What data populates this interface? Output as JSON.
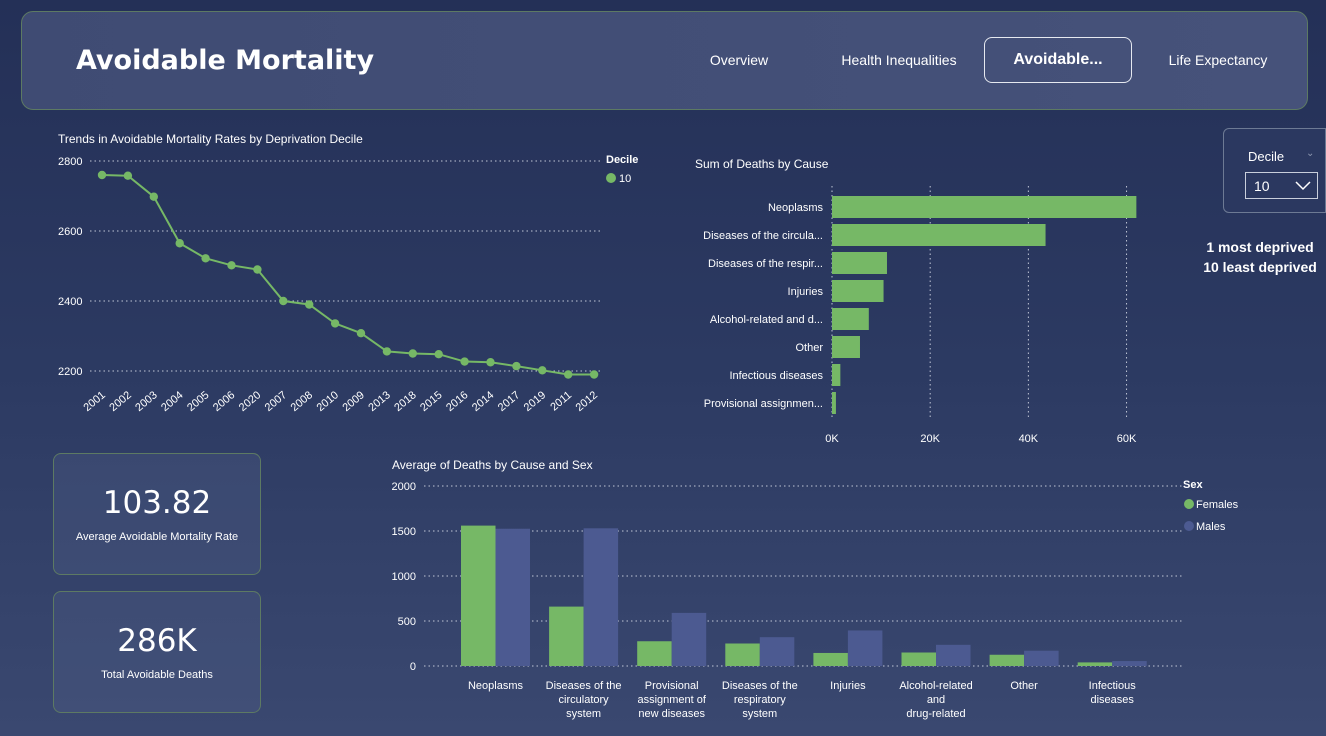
{
  "header": {
    "title": "Avoidable Mortality",
    "nav": [
      {
        "label": "Overview"
      },
      {
        "label": "Health Inequalities"
      },
      {
        "label": "Avoidable..."
      },
      {
        "label": "Life Expectancy"
      }
    ]
  },
  "slicer": {
    "title": "Decile",
    "value": "10"
  },
  "note": {
    "line1": "1 most deprived",
    "line2": "10 least deprived"
  },
  "kpi": {
    "avg_rate": {
      "value": "103.82",
      "label": "Average Avoidable Mortality Rate"
    },
    "total_deaths": {
      "value": "286K",
      "label": "Total Avoidable Deaths"
    }
  },
  "chart_data": [
    {
      "type": "line",
      "title": "Trends in Avoidable Mortality Rates by Deprivation Decile",
      "categories": [
        "2001",
        "2002",
        "2003",
        "2004",
        "2005",
        "2006",
        "2020",
        "2007",
        "2008",
        "2010",
        "2009",
        "2013",
        "2018",
        "2015",
        "2016",
        "2014",
        "2017",
        "2019",
        "2011",
        "2012"
      ],
      "series": [
        {
          "name": "10",
          "values": [
            2760,
            2758,
            2698,
            2565,
            2522,
            2502,
            2490,
            2400,
            2390,
            2336,
            2308,
            2256,
            2250,
            2248,
            2227,
            2225,
            2214,
            2202,
            2190,
            2190
          ]
        }
      ],
      "legend_title": "Decile",
      "yticks": [
        2200,
        2400,
        2600,
        2800
      ],
      "ylim": [
        2160,
        2810
      ],
      "color": "#76b866"
    },
    {
      "type": "bar",
      "orientation": "horizontal",
      "title": "Sum of Deaths  by Cause",
      "categories": [
        "Neoplasms",
        "Diseases of the circula...",
        "Diseases of the respir...",
        "Injuries",
        "Alcohol-related and d...",
        "Other",
        "Infectious diseases",
        "Provisional assignmen..."
      ],
      "values": [
        62000,
        43500,
        11200,
        10500,
        7500,
        5700,
        1700,
        800
      ],
      "xticks": [
        0,
        20000,
        40000,
        60000
      ],
      "xtick_labels": [
        "0K",
        "20K",
        "40K",
        "60K"
      ],
      "xlim": [
        0,
        66000
      ],
      "color": "#76b866"
    },
    {
      "type": "bar",
      "title": "Average of Deaths  by Cause and Sex",
      "categories": [
        [
          "Neoplasms"
        ],
        [
          "Diseases of the",
          "circulatory",
          "system"
        ],
        [
          "Provisional",
          "assignment of",
          "new diseases"
        ],
        [
          "Diseases of the",
          "respiratory",
          "system"
        ],
        [
          "Injuries"
        ],
        [
          "Alcohol-related",
          "and",
          "drug-related"
        ],
        [
          "Other"
        ],
        [
          "Infectious",
          "diseases"
        ]
      ],
      "legend_title": "Sex",
      "series": [
        {
          "name": "Females",
          "color": "#76b866",
          "values": [
            1560,
            660,
            275,
            250,
            145,
            150,
            125,
            40
          ]
        },
        {
          "name": "Males",
          "color": "#4c5a91",
          "values": [
            1525,
            1530,
            590,
            320,
            395,
            235,
            170,
            55
          ]
        }
      ],
      "yticks": [
        0,
        500,
        1000,
        1500,
        2000
      ],
      "ylim": [
        0,
        2000
      ]
    }
  ]
}
